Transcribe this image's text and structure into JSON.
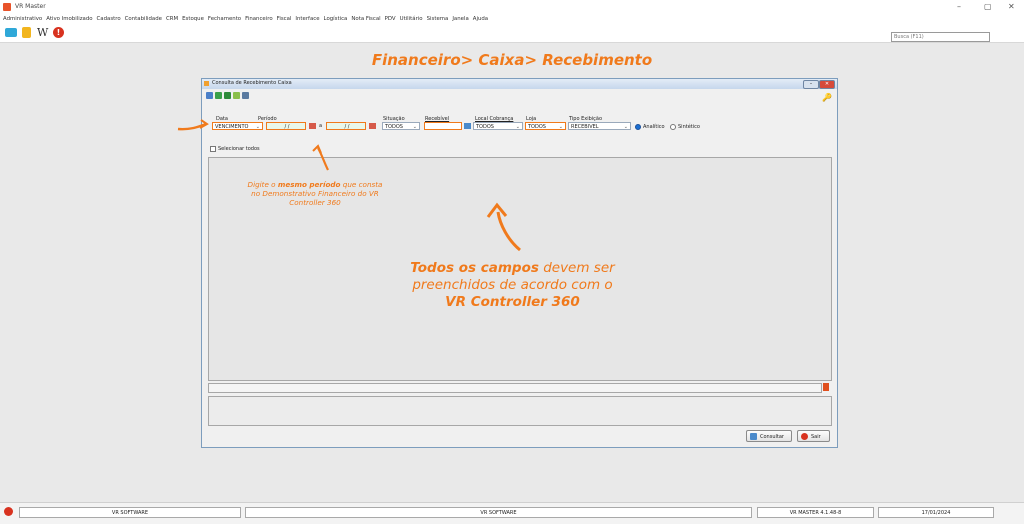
{
  "window": {
    "title": "VR Master",
    "controls": [
      "–",
      "▢",
      "✕"
    ]
  },
  "menu": [
    "Administrativo",
    "Ativo Imobilizado",
    "Cadastro",
    "Contabilidade",
    "CRM",
    "Estoque",
    "Fechamento",
    "Financeiro",
    "Fiscal",
    "Interface",
    "Logística",
    "Nota Fiscal",
    "PDV",
    "Utilitário",
    "Sistema",
    "Janela",
    "Ajuda"
  ],
  "search": {
    "placeholder": "Busca (F11)"
  },
  "headline": "Financeiro> Caixa> Recebimento",
  "dialog": {
    "title": "Consulta de Recebimento Caixa",
    "labels": {
      "data": "Data",
      "periodo": "Período",
      "situacao": "Situação",
      "recebivel": "Recebível",
      "local_cobranca": "Local Cobrança",
      "loja": "Loja",
      "tipo_exibicao": "Tipo Exibição"
    },
    "values": {
      "data": "VENCIMENTO",
      "date_from": " /  / ",
      "date_to": " /  / ",
      "periodo_separator": "a",
      "situacao": "TODOS",
      "recebivel": "",
      "local_cobranca": "TODOS",
      "loja": "TODOS",
      "tipo_exibicao": "RECEBIVEL"
    },
    "radio": {
      "analitico": "Analítico",
      "sintetico": "Sintético",
      "selected": "analitico"
    },
    "select_all": "Selecionar todos",
    "buttons": {
      "consultar": "Consultar",
      "sair": "Sair"
    }
  },
  "notes": {
    "period_line1": "Digite o",
    "period_bold": "mesmo período",
    "period_line1_end": "que consta",
    "period_line2": "no Demonstrativo Financeiro do VR",
    "period_line3": "Controller 360",
    "fields_bold1": "Todos os campos",
    "fields_line1_end": "devem ser",
    "fields_line2": "preenchidos de acordo com o",
    "fields_bold2": "VR Controller 360"
  },
  "statusbar": {
    "company_left": "VR SOFTWARE",
    "company_center": "VR SOFTWARE",
    "version": "VR MASTER 4.1.48-8",
    "date": "17/01/2024"
  },
  "colors": {
    "accent": "#f07a1c",
    "dialog_title": "#c6d7ec",
    "close": "#d64a3a"
  }
}
